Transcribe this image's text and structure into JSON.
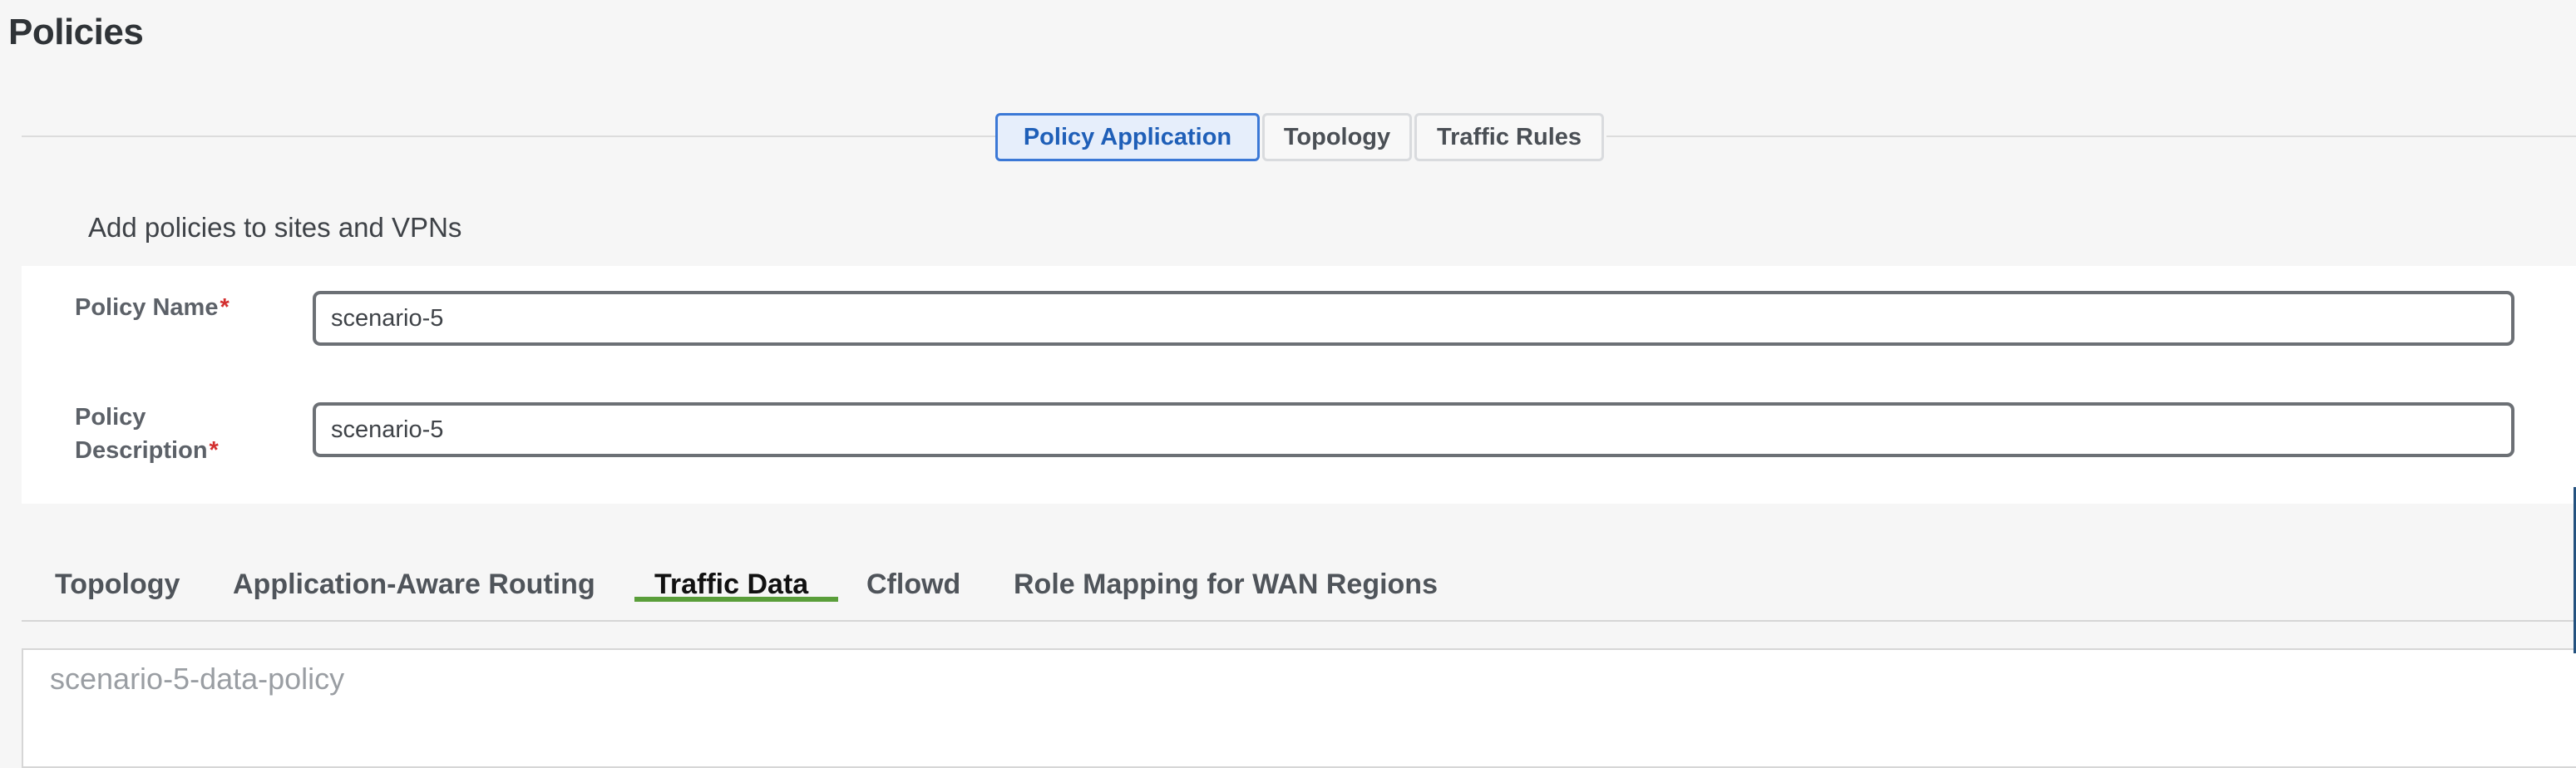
{
  "header": {
    "title": "Policies"
  },
  "segmented": {
    "items": [
      {
        "label": "Policy Application",
        "active": true
      },
      {
        "label": "Topology",
        "active": false
      },
      {
        "label": "Traffic Rules",
        "active": false
      }
    ]
  },
  "form": {
    "subtitle": "Add policies to sites and VPNs",
    "policy_name_label": "Policy Name",
    "policy_desc_label_line1": "Policy",
    "policy_desc_label_line2": "Description",
    "required_mark": "*",
    "policy_name_value": "scenario-5",
    "policy_desc_value": "scenario-5"
  },
  "tabs": {
    "items": [
      {
        "label": "Topology"
      },
      {
        "label": "Application-Aware Routing"
      },
      {
        "label": "Traffic Data"
      },
      {
        "label": "Cflowd"
      },
      {
        "label": "Role Mapping for WAN Regions"
      }
    ],
    "active_index": 2
  },
  "content": {
    "policy_item": "scenario-5-data-policy"
  },
  "colors": {
    "accent": "#3b78d6",
    "tab_active_underline": "#5a9e3a",
    "required": "#d32f2f"
  }
}
